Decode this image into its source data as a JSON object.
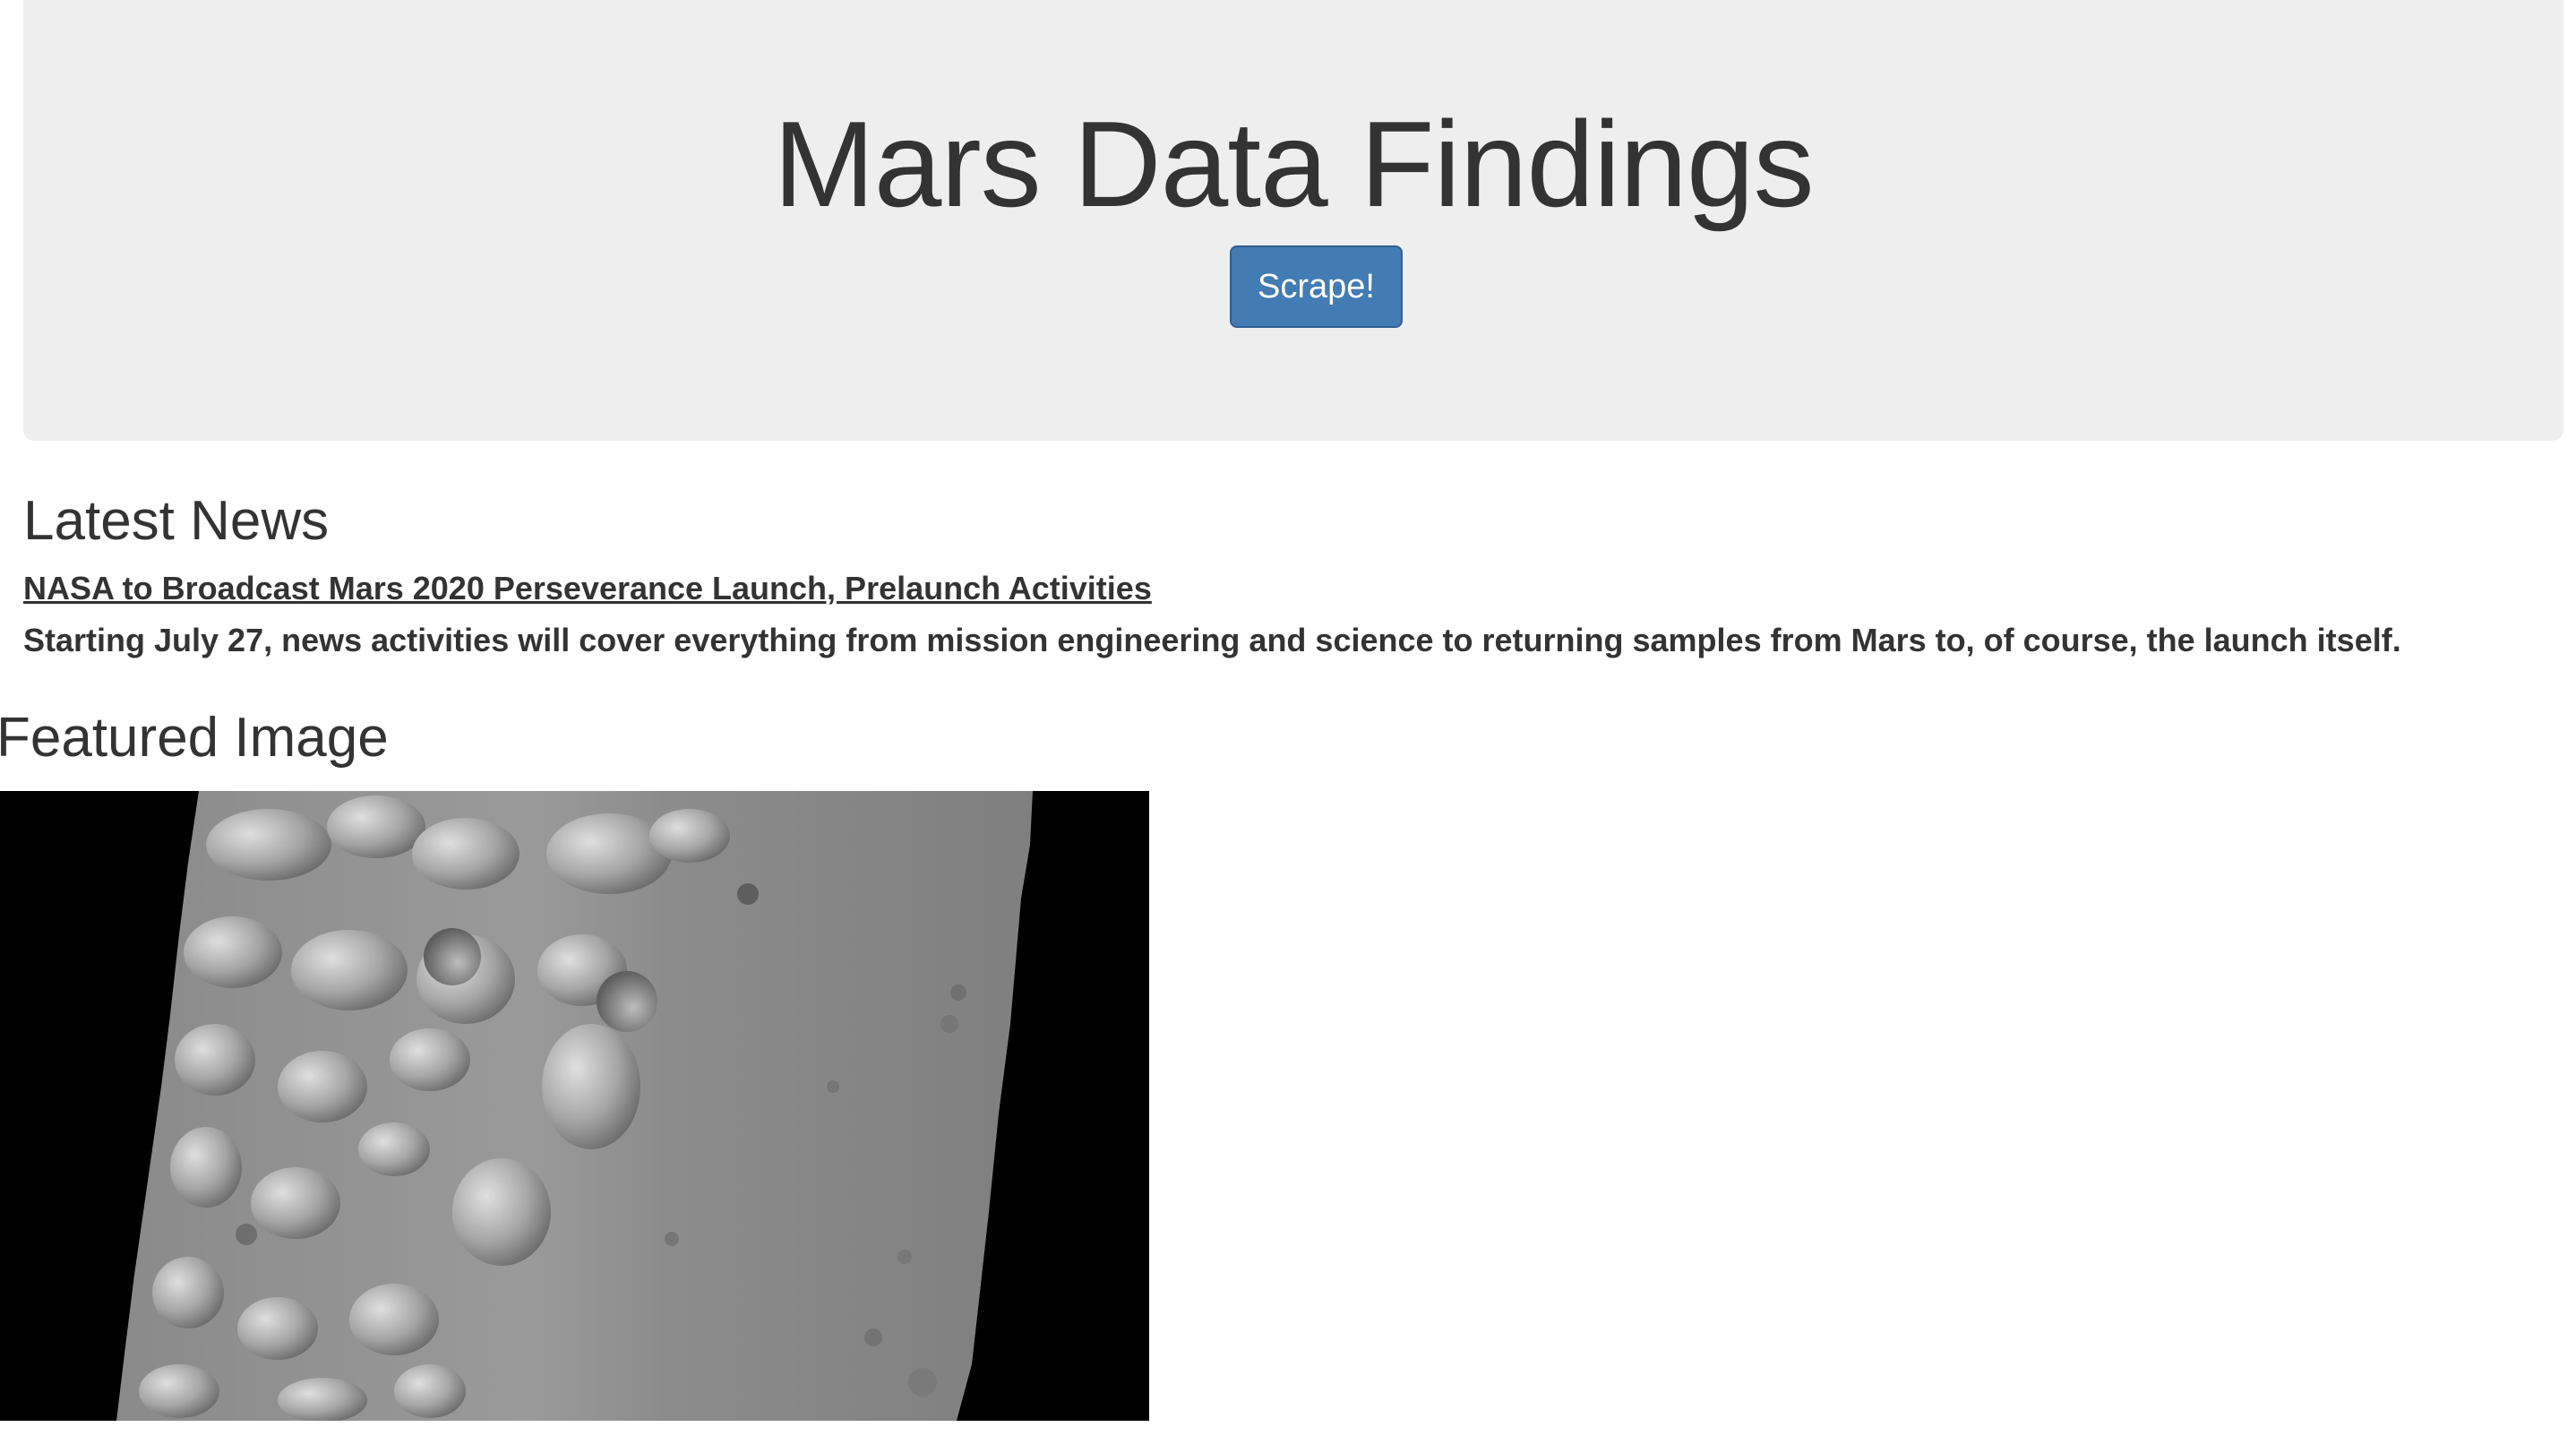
{
  "header": {
    "title": "Mars Data Findings",
    "scrape_label": "Scrape!"
  },
  "news": {
    "heading": "Latest News",
    "title": "NASA to Broadcast Mars 2020 Perseverance Launch, Prelaunch Activities",
    "teaser": "Starting July 27, news activities will cover everything from mission engineering and science to returning samples from Mars to, of course, the launch itself."
  },
  "featured": {
    "heading": "Featured Image"
  }
}
